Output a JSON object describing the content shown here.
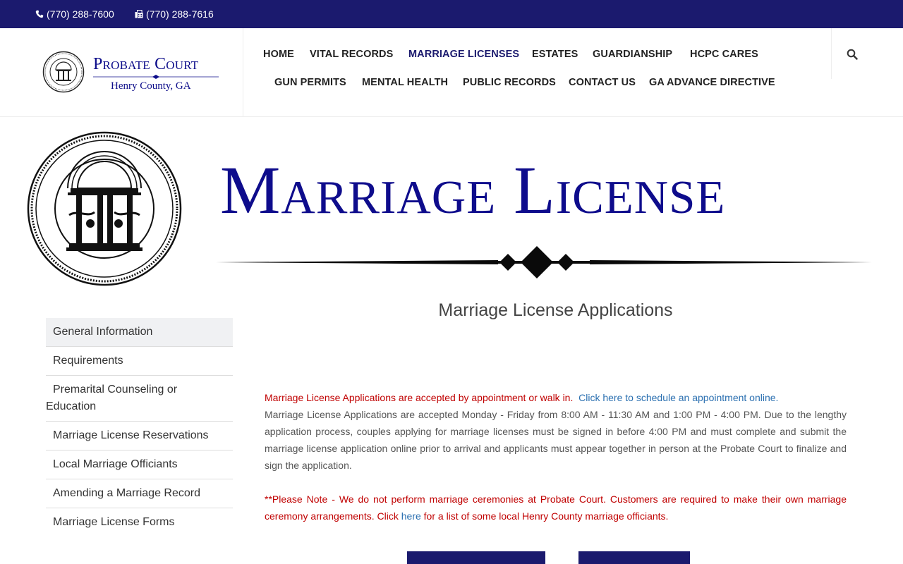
{
  "topbar": {
    "phone": "(770) 288-7600",
    "fax": "(770) 288-7616",
    "phone_icon": "phone-icon",
    "fax_icon": "fax-icon"
  },
  "logo": {
    "line1": "Probate Court",
    "line2": "Henry County, GA"
  },
  "nav": {
    "row1": [
      "HOME",
      "VITAL RECORDS",
      "MARRIAGE LICENSES",
      "ESTATES",
      "GUARDIANSHIP",
      "HCPC CARES"
    ],
    "row2": [
      "GUN PERMITS",
      "MENTAL HEALTH",
      "PUBLIC RECORDS",
      "CONTACT US",
      "GA ADVANCE DIRECTIVE"
    ],
    "active": "MARRIAGE LICENSES",
    "search_icon": "search-icon"
  },
  "banner": {
    "title": "Marriage License"
  },
  "sidebar": {
    "items": [
      "General Information",
      "Requirements",
      "Premarital Counseling or Education",
      "Marriage License Reservations",
      "Local Marriage Officiants",
      "Amending a Marriage Record",
      "Marriage License Forms"
    ]
  },
  "content": {
    "heading": "Marriage License Applications",
    "p1_red": "Marriage License Applications are accepted by appointment or walk in.",
    "p1_link": "Click here to schedule an appointment online.",
    "p1_body": "Marriage License Applications are accepted Monday - Friday from 8:00 AM - 11:30 AM and 1:00 PM - 4:00 PM.  Due to the lengthy application process, couples applying for marriage licenses must be signed in before 4:00 PM and must complete and submit the marriage license application online prior to arrival and applicants must appear together in person at the Probate Court to finalize and sign the application.",
    "note_before": "**Please Note - We do not perform marriage ceremonies at Probate Court.  Customers are required to make their own marriage ceremony arrangements.  Click ",
    "note_link": "here",
    "note_after": " for a list of some local Henry County marriage officiants."
  },
  "colors": {
    "navy": "#1b1a6e",
    "title_blue": "#0e0c8c",
    "red": "#c00000",
    "link": "#2a6fb0"
  }
}
